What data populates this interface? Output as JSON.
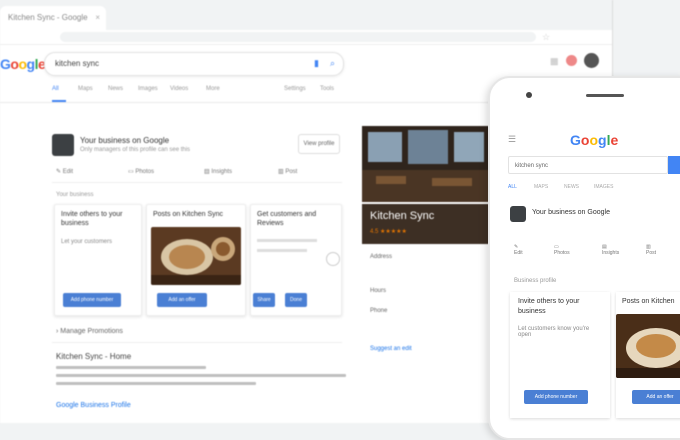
{
  "colors": {
    "blue": "#4285f4",
    "red": "#ea4335",
    "yellow": "#fbbc05",
    "green": "#34a853",
    "button": "#4a7fd4"
  },
  "browser": {
    "tab_title": "Kitchen Sync - Google Search",
    "search_query": "kitchen sync"
  },
  "logo": "Google",
  "nav": {
    "tabs": [
      "All",
      "Maps",
      "News",
      "Images",
      "Videos",
      "More"
    ],
    "tools": "Settings",
    "tools2": "Tools"
  },
  "business": {
    "title": "Your business on Google",
    "subtitle": "Only managers of this profile can see this",
    "view_profile": "View profile"
  },
  "actions": [
    {
      "icon": "edit-icon",
      "label": "Edit"
    },
    {
      "icon": "photo-icon",
      "label": "Photos"
    },
    {
      "icon": "insights-icon",
      "label": "Insights"
    },
    {
      "icon": "post-icon",
      "label": "Post"
    }
  ],
  "section_heading": "Your business",
  "cards": [
    {
      "title": "Invite others to your",
      "title2": "business",
      "text": "Let your customers",
      "button": "Add phone number"
    },
    {
      "title": "Posts on Kitchen Sync",
      "button": "Add an offer"
    },
    {
      "title": "Get customers and",
      "title2": "Reviews",
      "text": "",
      "button": "Share",
      "button2": "Done"
    }
  ],
  "more": "Manage Promotions",
  "result": {
    "title": "Kitchen Sync - Home",
    "lines": 3,
    "foot": "Google Business Profile"
  },
  "knowledge": {
    "name": "Kitchen Sync",
    "rating": "4.5 ★★★★★",
    "sections": [
      "Address",
      "Hours",
      "Phone",
      "Suggest an edit"
    ]
  },
  "phone": {
    "logo": "Google",
    "query": "kitchen sync",
    "tabs": [
      "ALL",
      "MAPS",
      "NEWS",
      "IMAGES"
    ],
    "title": "Your business on Google",
    "actions": [
      "Edit",
      "Photos",
      "Insights",
      "Post"
    ],
    "section": "Business profile",
    "card1": "Invite others to your",
    "card1b": "business",
    "card1_text": "Let customers know you're open",
    "button1": "Add phone number",
    "card2": "Posts on Kitchen",
    "button2": "Add an offer"
  }
}
